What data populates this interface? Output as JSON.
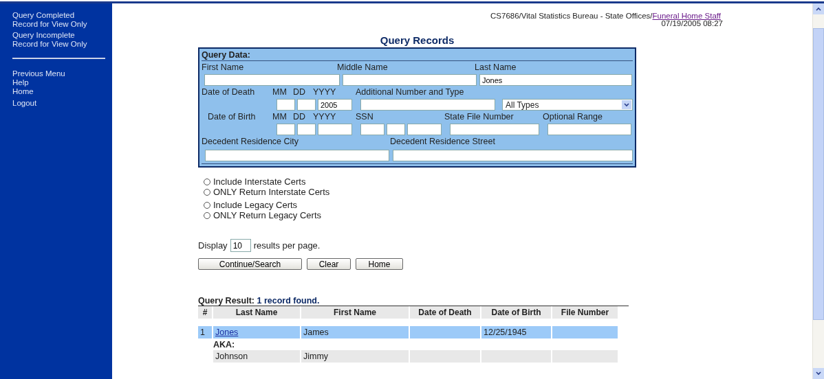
{
  "sidebar": {
    "sections": [
      [
        {
          "label": "Query Completed Record for View Only"
        },
        {
          "label": "Query Incomplete Record for View Only"
        }
      ],
      [
        {
          "label": "Previous Menu"
        },
        {
          "label": "Help"
        },
        {
          "label": "Home"
        }
      ],
      [
        {
          "label": "Logout"
        }
      ]
    ]
  },
  "header": {
    "path": "CS7686/Vital Statistics Bureau - State Offices/",
    "user_link": "Funeral Home Staff",
    "datetime": "07/19/2005 08:27"
  },
  "title": "Query Records",
  "query_data": {
    "title": "Query Data:",
    "first_name": {
      "label": "First Name"
    },
    "middle_name": {
      "label": "Middle Name"
    },
    "last_name": {
      "label": "Last Name",
      "value": "Jones"
    },
    "date_of_death": {
      "label": "Date of Death",
      "mm": "MM",
      "dd": "DD",
      "yyyy": "YYYY",
      "year_value": "2005"
    },
    "additional_number": {
      "label": "Additional Number and Type",
      "type_value": "All Types"
    },
    "date_of_birth": {
      "label": "Date of Birth",
      "mm": "MM",
      "dd": "DD",
      "yyyy": "YYYY"
    },
    "ssn": {
      "label": "SSN"
    },
    "state_file_number": {
      "label": "State File Number"
    },
    "optional_range": {
      "label": "Optional Range"
    },
    "residence_city": {
      "label": "Decedent Residence City"
    },
    "residence_street": {
      "label": "Decedent Residence Street"
    }
  },
  "radio_groups": [
    [
      {
        "label": "Include Interstate Certs",
        "selected": false
      },
      {
        "label": "ONLY Return Interstate Certs",
        "selected": false
      }
    ],
    [
      {
        "label": "Include Legacy Certs",
        "selected": false
      },
      {
        "label": "ONLY Return Legacy Certs",
        "selected": false
      }
    ]
  ],
  "display": {
    "label": "Display",
    "value": "10",
    "suffix": "results per page."
  },
  "buttons": [
    "Continue/Search",
    "Clear",
    "Home"
  ],
  "results": {
    "title": "Query Result:",
    "count": "1 record found.",
    "columns": [
      "#",
      "Last Name",
      "First Name",
      "Date of Death",
      "Date of Birth",
      "File Number"
    ],
    "rows": [
      {
        "number": "1",
        "last_name": "Jones",
        "first_name": "James",
        "date_of_death": "",
        "date_of_birth": "12/25/1945",
        "file_number": "",
        "selected": true
      }
    ],
    "aka_label": "AKA:",
    "aka_rows": [
      {
        "last_name": "Johnson",
        "first_name": "Jimmy"
      }
    ]
  }
}
